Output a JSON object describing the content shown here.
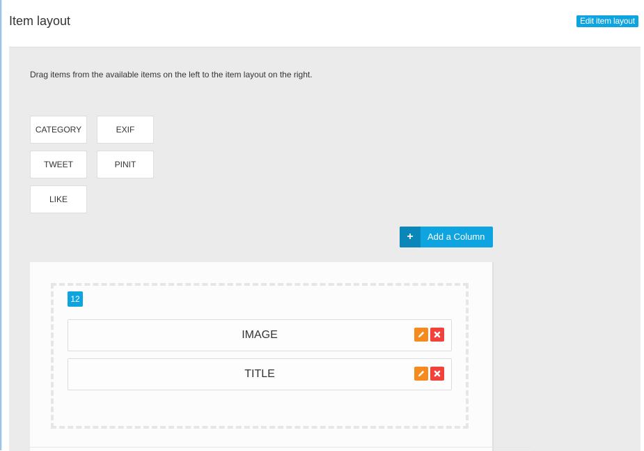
{
  "header": {
    "title": "Item layout",
    "edit_button_label": "Edit item layout"
  },
  "panel": {
    "instructions": "Drag items from the available items on the left to the item layout on the right.",
    "available_items": [
      {
        "label": "CATEGORY"
      },
      {
        "label": "EXIF"
      },
      {
        "label": "TWEET"
      },
      {
        "label": "PINIT"
      },
      {
        "label": "LIKE"
      }
    ],
    "add_column": {
      "icon": "plus-icon",
      "label": "Add a Column"
    }
  },
  "layout": {
    "columns": [
      {
        "width_badge": "12",
        "items": [
          {
            "label": "IMAGE",
            "edit_icon": "pencil-icon",
            "remove_icon": "close-icon"
          },
          {
            "label": "TITLE",
            "edit_icon": "pencil-icon",
            "remove_icon": "close-icon"
          }
        ]
      }
    ]
  },
  "colors": {
    "accent": "#0ea4e0",
    "accent_dark": "#0a86b8",
    "edit": "#f58a1f",
    "delete": "#f2413a",
    "panel_bg": "#ebebeb"
  },
  "plus_glyph": "+"
}
